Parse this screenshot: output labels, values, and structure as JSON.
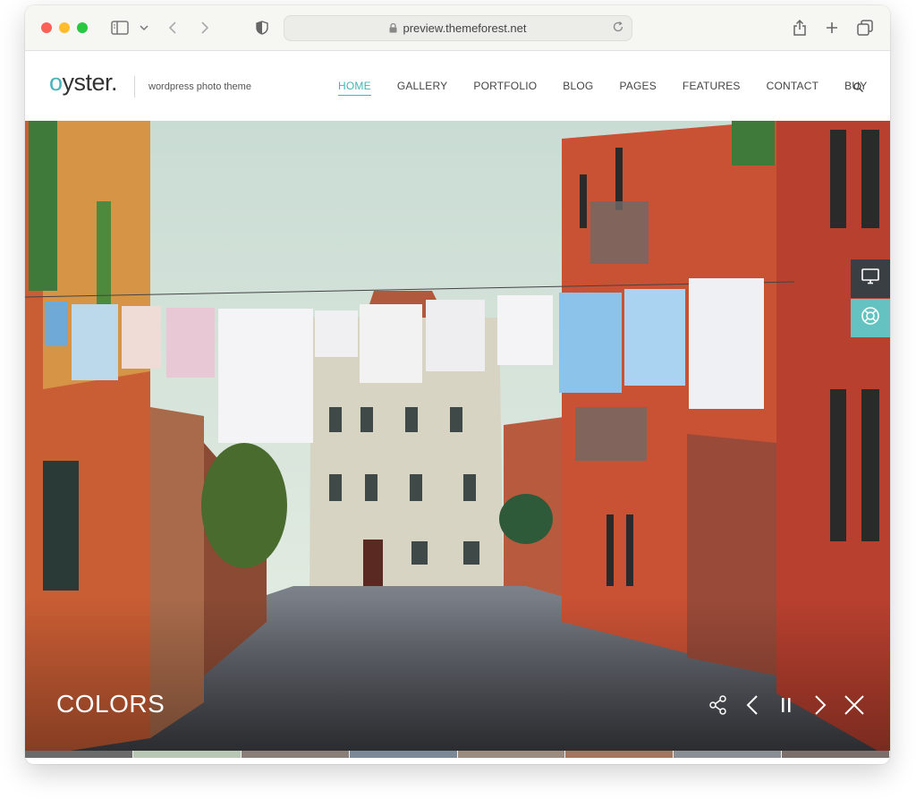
{
  "browser": {
    "url": "preview.themeforest.net"
  },
  "site": {
    "logo_mark": "o",
    "logo_rest": "yster.",
    "tagline": "wordpress photo theme",
    "nav": [
      {
        "label": "HOME",
        "active": true
      },
      {
        "label": "GALLERY",
        "active": false
      },
      {
        "label": "PORTFOLIO",
        "active": false
      },
      {
        "label": "BLOG",
        "active": false
      },
      {
        "label": "PAGES",
        "active": false
      },
      {
        "label": "FEATURES",
        "active": false
      },
      {
        "label": "CONTACT",
        "active": false
      },
      {
        "label": "BUY",
        "active": false
      }
    ]
  },
  "hero": {
    "title": "COLORS"
  },
  "colors": {
    "accent": "#43b4b9",
    "side_dark": "#3a3f44",
    "side_teal": "#64c3c1"
  },
  "icons": {
    "sidebar_toggle": "sidebar-icon",
    "privacy": "shield-icon",
    "share_browser": "share-icon",
    "new_tab": "plus-icon",
    "tabs": "tabs-icon",
    "search": "search-icon",
    "slide_share": "share-nodes-icon",
    "prev": "chevron-left-icon",
    "pause": "pause-icon",
    "next": "chevron-right-icon",
    "close": "close-icon",
    "desktop": "monitor-icon",
    "help": "lifebuoy-icon"
  }
}
